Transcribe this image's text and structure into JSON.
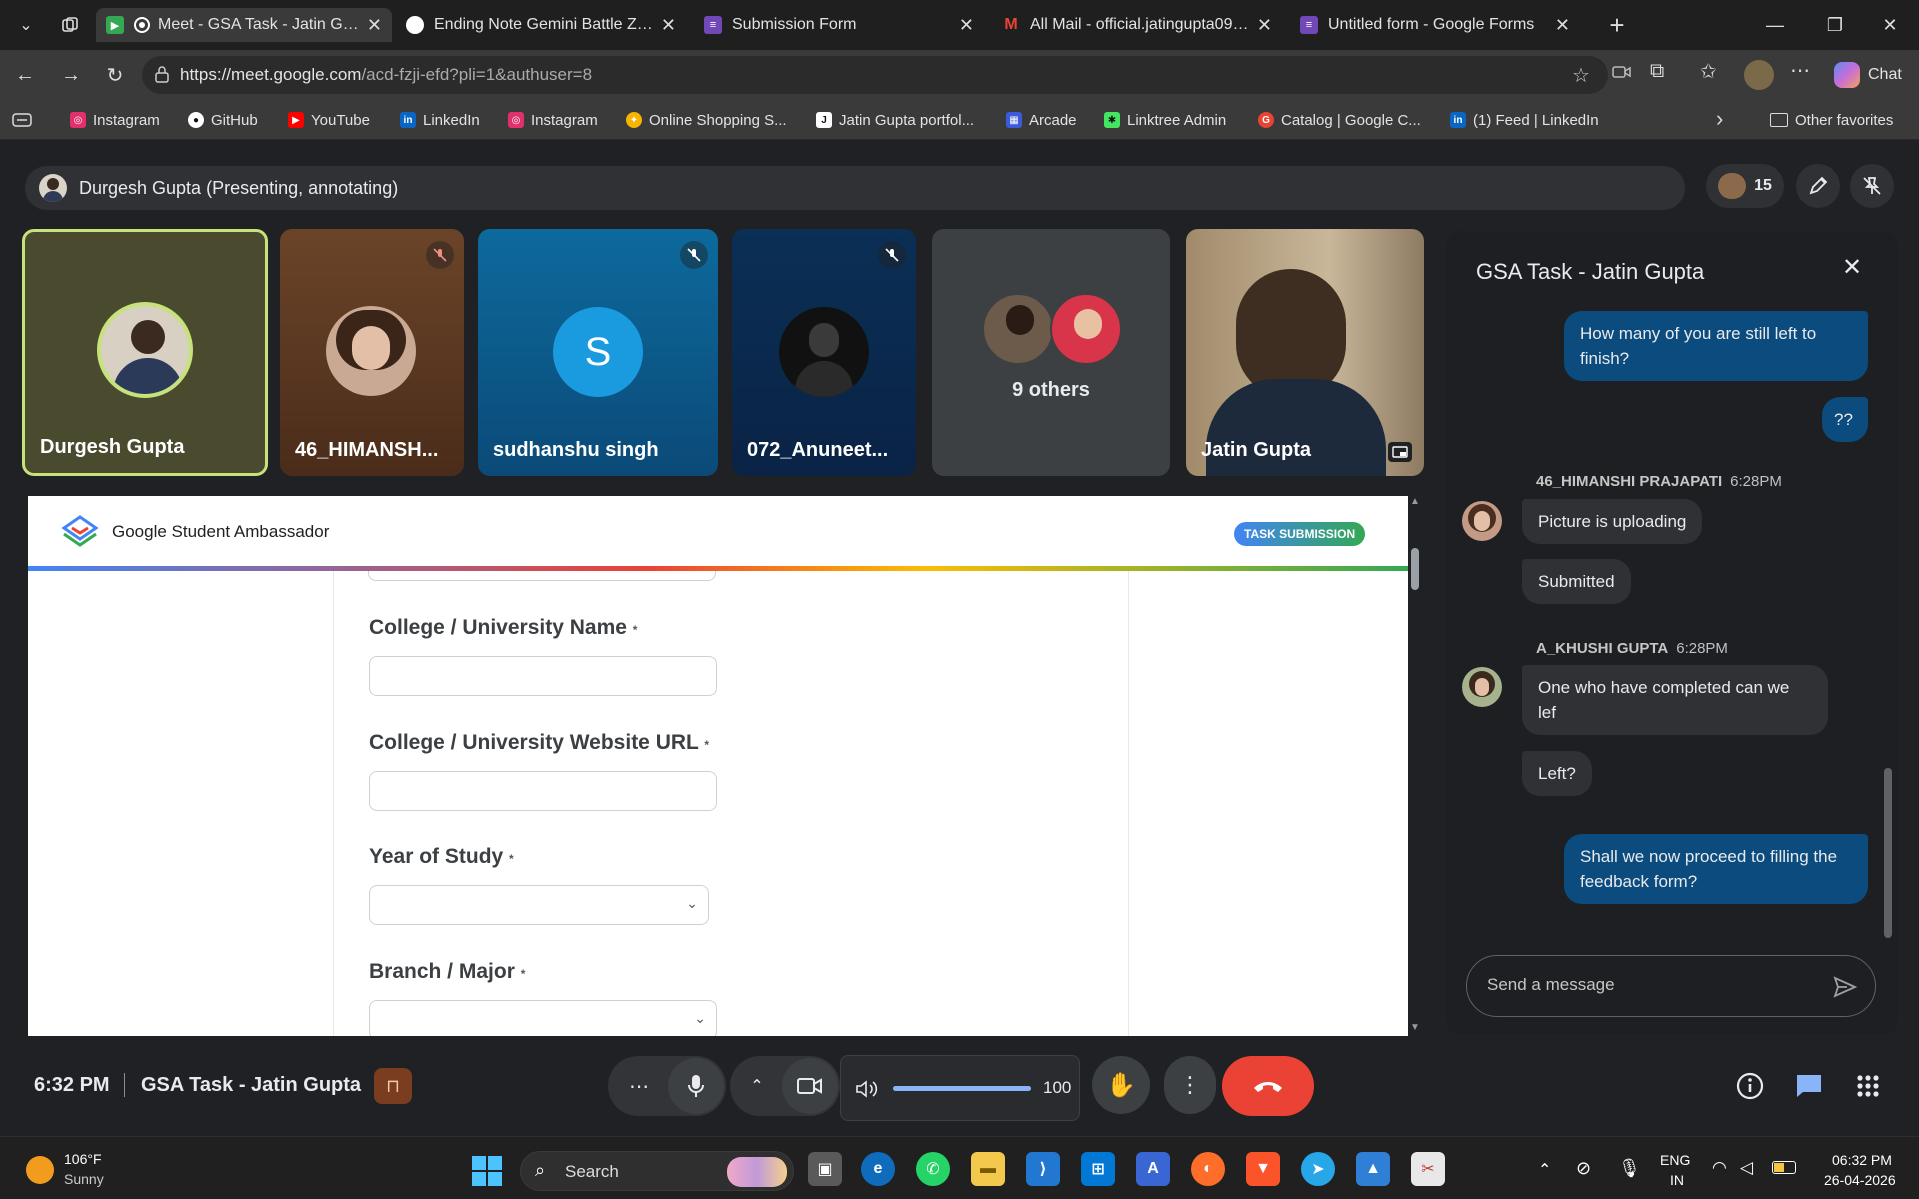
{
  "tabs": [
    {
      "title": "Meet - GSA Task - Jatin Gupta",
      "fav_color": "#34a853",
      "active": true
    },
    {
      "title": "Ending Note Gemini Battle Zone",
      "fav_color": "#ffffff",
      "active": false
    },
    {
      "title": "Submission Form",
      "fav_color": "#7248b9",
      "active": false
    },
    {
      "title": "All Mail - official.jatingupta09@gm",
      "fav_color": "#ea4335",
      "active": false
    },
    {
      "title": "Untitled form - Google Forms",
      "fav_color": "#7248b9",
      "active": false
    }
  ],
  "address": {
    "url_host": "https://meet.google.com",
    "url_path": "/acd-fzji-efd?pli=1&authuser=8"
  },
  "copilot": {
    "label": "Chat"
  },
  "bookmarks": [
    {
      "label": "Instagram",
      "color": "#e1306c"
    },
    {
      "label": "GitHub",
      "color": "#ffffff"
    },
    {
      "label": "YouTube",
      "color": "#ff0000"
    },
    {
      "label": "LinkedIn",
      "color": "#0a66c2"
    },
    {
      "label": "Instagram",
      "color": "#e1306c"
    },
    {
      "label": "Online Shopping S...",
      "color": "#f7b500"
    },
    {
      "label": "Jatin Gupta portfol...",
      "color": "#ffffff"
    },
    {
      "label": "Arcade",
      "color": "#3b5bdb"
    },
    {
      "label": "Linktree Admin",
      "color": "#43e660"
    },
    {
      "label": "Catalog | Google C...",
      "color": "#ea4335"
    },
    {
      "label": "(1) Feed | LinkedIn",
      "color": "#0a66c2"
    }
  ],
  "other_favorites": "Other favorites",
  "presenting": {
    "label": "Durgesh Gupta (Presenting, annotating)",
    "participant_count": "15"
  },
  "tiles": [
    {
      "name": "Durgesh Gupta",
      "bg": "#4a4a2f"
    },
    {
      "name": "46_HIMANSH...",
      "bg": "#5a3a24"
    },
    {
      "name": "sudhanshu singh",
      "bg": "#0f5a86",
      "initial": "S"
    },
    {
      "name": "072_Anuneet...",
      "bg": "#0b2e55"
    },
    {
      "name": "9 others",
      "bg": "#3c4043"
    },
    {
      "name": "Jatin Gupta",
      "bg": "#6b5b47"
    }
  ],
  "screen": {
    "brand": "Google Student Ambassador",
    "badge": "TASK SUBMISSION",
    "fields": [
      {
        "label": "College / University Name",
        "required": "*",
        "type": "text"
      },
      {
        "label": "College / University Website URL",
        "required": "*",
        "type": "text"
      },
      {
        "label": "Year of Study",
        "required": "*",
        "type": "select"
      },
      {
        "label": "Branch / Major",
        "required": "*",
        "type": "select"
      }
    ]
  },
  "chat": {
    "title": "GSA Task - Jatin Gupta",
    "messages": [
      {
        "kind": "me",
        "text": "How many of you are still left to finish?"
      },
      {
        "kind": "me",
        "text": "??"
      },
      {
        "kind": "sender",
        "name": "46_HIMANSHI PRAJAPATI",
        "time": "6:28PM"
      },
      {
        "kind": "them",
        "text": "Picture is uploading"
      },
      {
        "kind": "them",
        "text": "Submitted"
      },
      {
        "kind": "sender",
        "name": "A_KHUSHI GUPTA",
        "time": "6:28PM"
      },
      {
        "kind": "them",
        "text": "One who have completed can we lef"
      },
      {
        "kind": "them",
        "text": "Left?"
      },
      {
        "kind": "me",
        "text": "Shall we now proceed to filling the feedback form?"
      }
    ],
    "input_placeholder": "Send a message"
  },
  "bottom": {
    "time": "6:32 PM",
    "meeting_name": "GSA Task - Jatin Gupta",
    "volume": "100"
  },
  "taskbar": {
    "weather_temp": "106°F",
    "weather_desc": "Sunny",
    "search_label": "Search",
    "lang_top": "ENG",
    "lang_bottom": "IN",
    "clock_time": "06:32 PM",
    "clock_date": "26-04-2026"
  }
}
